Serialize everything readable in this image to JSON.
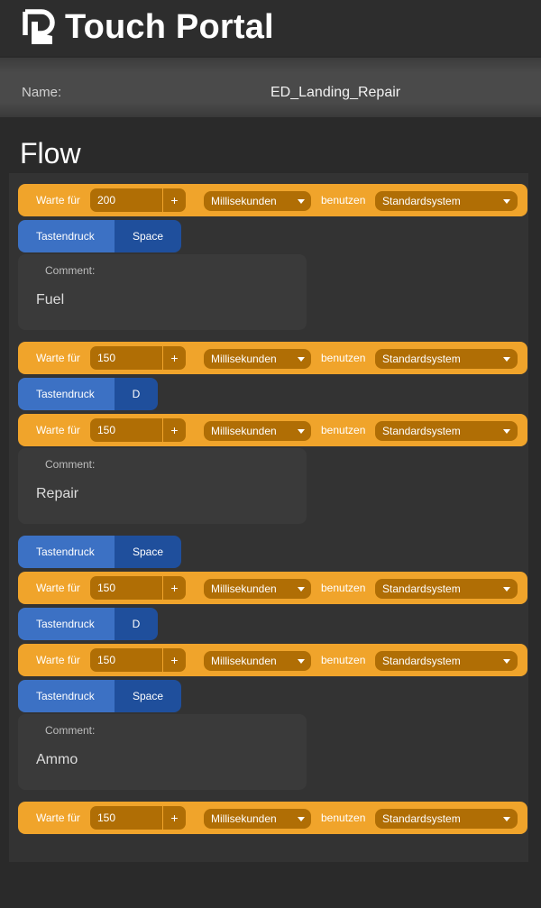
{
  "app": {
    "brand": "Touch Portal"
  },
  "name": {
    "label": "Name:",
    "value": "ED_Landing_Repair"
  },
  "flow": {
    "title": "Flow",
    "labels": {
      "wait": "Warte für",
      "plus": "+",
      "use": "benutzen",
      "key": "Tastendruck",
      "comment": "Comment:"
    },
    "actions": [
      {
        "type": "wait",
        "value": "200",
        "unit": "Millisekunden",
        "system": "Standardsystem"
      },
      {
        "type": "key",
        "key": "Space"
      },
      {
        "type": "comment",
        "text": "Fuel"
      },
      {
        "type": "wait",
        "value": "150",
        "unit": "Millisekunden",
        "system": "Standardsystem"
      },
      {
        "type": "key",
        "key": "D"
      },
      {
        "type": "wait",
        "value": "150",
        "unit": "Millisekunden",
        "system": "Standardsystem"
      },
      {
        "type": "comment",
        "text": "Repair"
      },
      {
        "type": "key",
        "key": "Space"
      },
      {
        "type": "wait",
        "value": "150",
        "unit": "Millisekunden",
        "system": "Standardsystem"
      },
      {
        "type": "key",
        "key": "D"
      },
      {
        "type": "wait",
        "value": "150",
        "unit": "Millisekunden",
        "system": "Standardsystem"
      },
      {
        "type": "key",
        "key": "Space"
      },
      {
        "type": "comment",
        "text": "Ammo"
      },
      {
        "type": "wait",
        "value": "150",
        "unit": "Millisekunden",
        "system": "Standardsystem"
      }
    ]
  },
  "colors": {
    "wait": "#f0a42b",
    "wait_field": "#b06e05",
    "key_label": "#3c71c4",
    "key_value": "#1f4f9c",
    "background": "#2a2a2a"
  }
}
